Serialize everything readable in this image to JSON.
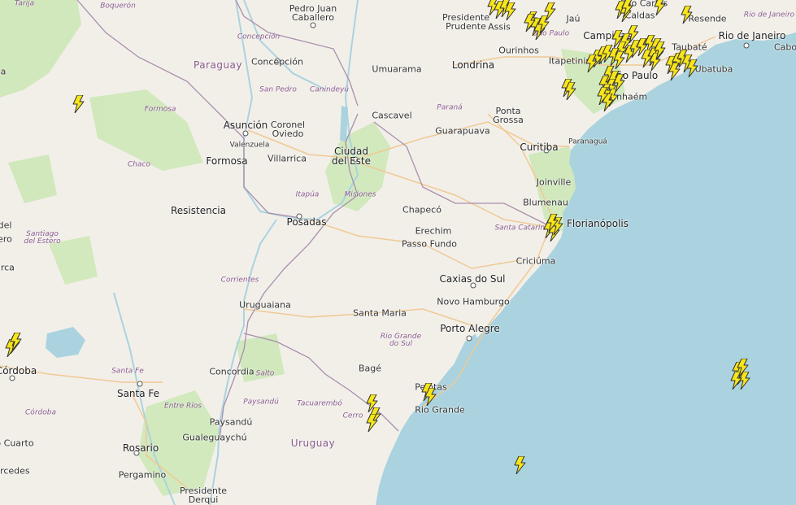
{
  "map": {
    "colors": {
      "land": "#f2efe9",
      "ocean": "#aad3df",
      "forest": "#cde8b8",
      "border": "#a98fad",
      "road": "#f0c994",
      "lightning": "#f7e51a"
    },
    "countries": [
      {
        "id": "paraguay",
        "name": "Paraguay"
      },
      {
        "id": "uruguay",
        "name": "Uruguay"
      }
    ],
    "regions": [
      {
        "id": "tarija",
        "name": "Tarija"
      },
      {
        "id": "boqueron",
        "name": "Boquerón"
      },
      {
        "id": "concepcion-dept",
        "name": "Concepción"
      },
      {
        "id": "san-pedro",
        "name": "San Pedro"
      },
      {
        "id": "canindeyu",
        "name": "Canindeyú"
      },
      {
        "id": "formosa-prov",
        "name": "Formosa"
      },
      {
        "id": "chaco",
        "name": "Chaco"
      },
      {
        "id": "itapua",
        "name": "Itapúa"
      },
      {
        "id": "misiones",
        "name": "Misiones"
      },
      {
        "id": "parana",
        "name": "Paraná"
      },
      {
        "id": "sao-paulo-state",
        "name": "São Paulo"
      },
      {
        "id": "santa-catarina",
        "name": "Santa Catarina"
      },
      {
        "id": "santiago-estero",
        "name": "Santiago del Estero"
      },
      {
        "id": "corrientes",
        "name": "Corrientes"
      },
      {
        "id": "rio-grande-do-sul",
        "name": "Rio Grande do Sul"
      },
      {
        "id": "santa-fe-prov",
        "name": "Santa Fe"
      },
      {
        "id": "entre-rios",
        "name": "Entre Ríos"
      },
      {
        "id": "salto",
        "name": "Salto"
      },
      {
        "id": "paysandu-dept",
        "name": "Paysandú"
      },
      {
        "id": "tacuarembo",
        "name": "Tacuarembó"
      },
      {
        "id": "cerro-largo",
        "name": "Cerro"
      },
      {
        "id": "cordoba-prov",
        "name": "Córdoba"
      },
      {
        "id": "rio-de-janeiro-state",
        "name": "Rio de Janeiro"
      }
    ],
    "cities": [
      {
        "id": "pedro-juan",
        "name": "Pedro Juan Caballero"
      },
      {
        "id": "presidente-prudente",
        "name": "Presidente Prudente"
      },
      {
        "id": "assis",
        "name": "Assis"
      },
      {
        "id": "jau",
        "name": "Jaú"
      },
      {
        "id": "sao-carlos",
        "name": "São Carlos"
      },
      {
        "id": "caldas",
        "name": "Caldas"
      },
      {
        "id": "campinas",
        "name": "Campinas"
      },
      {
        "id": "resende",
        "name": "Resende"
      },
      {
        "id": "rio-de-janeiro",
        "name": "Rio de Janeiro"
      },
      {
        "id": "cabo-frio",
        "name": "Cabo"
      },
      {
        "id": "concepcion",
        "name": "Concepción"
      },
      {
        "id": "umuarama",
        "name": "Umuarama"
      },
      {
        "id": "londrina",
        "name": "Londrina"
      },
      {
        "id": "ourinhos",
        "name": "Ourinhos"
      },
      {
        "id": "itapetininga",
        "name": "Itapetininga"
      },
      {
        "id": "taubate",
        "name": "Taubaté"
      },
      {
        "id": "sao-paulo",
        "name": "São Paulo"
      },
      {
        "id": "ubatuba",
        "name": "Ubatuba"
      },
      {
        "id": "anhaem",
        "name": "Itanhaém"
      },
      {
        "id": "cascavel",
        "name": "Cascavel"
      },
      {
        "id": "ponta-grossa",
        "name": "Ponta Grossa"
      },
      {
        "id": "asuncion",
        "name": "Asunción"
      },
      {
        "id": "coronel-oviedo",
        "name": "Coronel Oviedo"
      },
      {
        "id": "valenzuela",
        "name": "Valenzuela"
      },
      {
        "id": "villarrica",
        "name": "Villarrica"
      },
      {
        "id": "ciudad-del-este",
        "name": "Ciudad del Este"
      },
      {
        "id": "guarapuava",
        "name": "Guarapuava"
      },
      {
        "id": "curitiba",
        "name": "Curitiba"
      },
      {
        "id": "paranagua",
        "name": "Paranaguá"
      },
      {
        "id": "formosa",
        "name": "Formosa"
      },
      {
        "id": "joinville",
        "name": "Joinville"
      },
      {
        "id": "blumenau",
        "name": "Blumenau"
      },
      {
        "id": "resistencia",
        "name": "Resistencia"
      },
      {
        "id": "posadas",
        "name": "Posadas"
      },
      {
        "id": "chapeco",
        "name": "Chapecó"
      },
      {
        "id": "erechim",
        "name": "Erechim"
      },
      {
        "id": "florianopolis",
        "name": "Florianópolis"
      },
      {
        "id": "passo-fundo",
        "name": "Passo Fundo"
      },
      {
        "id": "criciuma",
        "name": "Criciúma"
      },
      {
        "id": "caxias",
        "name": "Caxias do Sul"
      },
      {
        "id": "novo-hamburgo",
        "name": "Novo Hamburgo"
      },
      {
        "id": "uruguaiana",
        "name": "Uruguaiana"
      },
      {
        "id": "santa-maria",
        "name": "Santa Maria"
      },
      {
        "id": "porto-alegre",
        "name": "Porto Alegre"
      },
      {
        "id": "cordoba",
        "name": "Córdoba"
      },
      {
        "id": "concordia",
        "name": "Concordia"
      },
      {
        "id": "bage",
        "name": "Bagé"
      },
      {
        "id": "pelotas",
        "name": "Pelotas"
      },
      {
        "id": "santa-fe",
        "name": "Santa Fe"
      },
      {
        "id": "rio-grande",
        "name": "Rio Grande"
      },
      {
        "id": "paysandu",
        "name": "Paysandú"
      },
      {
        "id": "gualeguaychu",
        "name": "Gualeguaychú"
      },
      {
        "id": "rosario",
        "name": "Rosario"
      },
      {
        "id": "rio-cuarto",
        "name": "o Cuarto"
      },
      {
        "id": "pergamino",
        "name": "Pergamino"
      },
      {
        "id": "mercedes",
        "name": "ercedes"
      },
      {
        "id": "presidente-derqui",
        "name": "Presidente Derqui"
      },
      {
        "id": "edge-del",
        "name": "del"
      },
      {
        "id": "edge-ero",
        "name": "ero"
      },
      {
        "id": "edge-arca",
        "name": "arca"
      },
      {
        "id": "edge-a",
        "name": "a"
      }
    ],
    "lightning_count": 78
  }
}
